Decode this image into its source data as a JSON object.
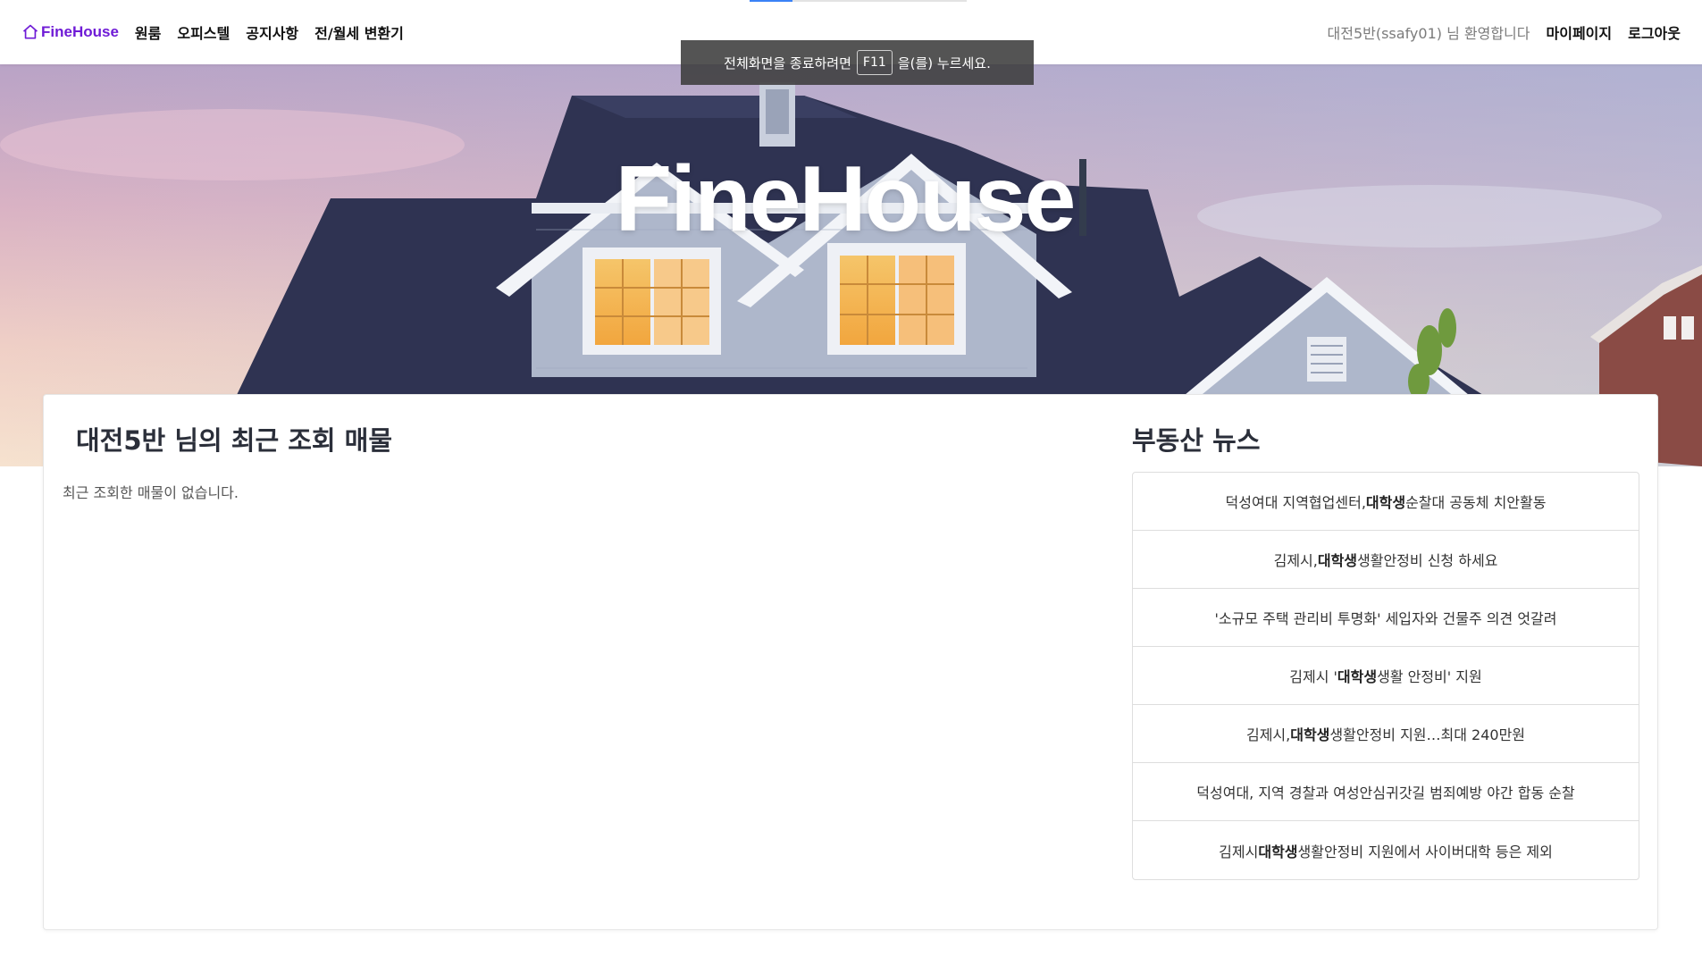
{
  "nav": {
    "brand": "FineHouse",
    "links": [
      "원룸",
      "오피스텔",
      "공지사항",
      "전/월세 변환기"
    ],
    "welcome": "대전5반(ssafy01) 님 환영합니다",
    "mypage": "마이페이지",
    "logout": "로그아웃"
  },
  "fullscreen_toast": {
    "before": "전체화면을 종료하려면",
    "key": "F11",
    "after": "을(를) 누르세요."
  },
  "hero": {
    "title": "FineHouse"
  },
  "recent": {
    "title": "대전5반 님의 최근 조회 매물",
    "empty": "최근 조회한 매물이 없습니다."
  },
  "news": {
    "title": "부동산 뉴스",
    "items": [
      {
        "pre": "덕성여대 지역협업센터, ",
        "bold": "대학생",
        "post": " 순찰대 공동체 치안활동"
      },
      {
        "pre": "김제시, ",
        "bold": "대학생",
        "post": " 생활안정비 신청 하세요"
      },
      {
        "pre": "'소규모 주택 관리비 투명화' 세입자와 건물주 의견 엇갈려",
        "bold": "",
        "post": ""
      },
      {
        "pre": "김제시 '",
        "bold": "대학생",
        "post": " 생활 안정비' 지원"
      },
      {
        "pre": "김제시, ",
        "bold": "대학생",
        "post": " 생활안정비 지원…최대 240만원"
      },
      {
        "pre": "덕성여대, 지역 경찰과 여성안심귀갓길 범죄예방 야간 합동 순찰",
        "bold": "",
        "post": ""
      },
      {
        "pre": "김제시 ",
        "bold": "대학생",
        "post": " 생활안정비 지원에서 사이버대학 등은 제외"
      }
    ]
  },
  "colors": {
    "brand": "#6f1bd6",
    "roof": "#2f3352",
    "siding": "#b8c0d2"
  }
}
